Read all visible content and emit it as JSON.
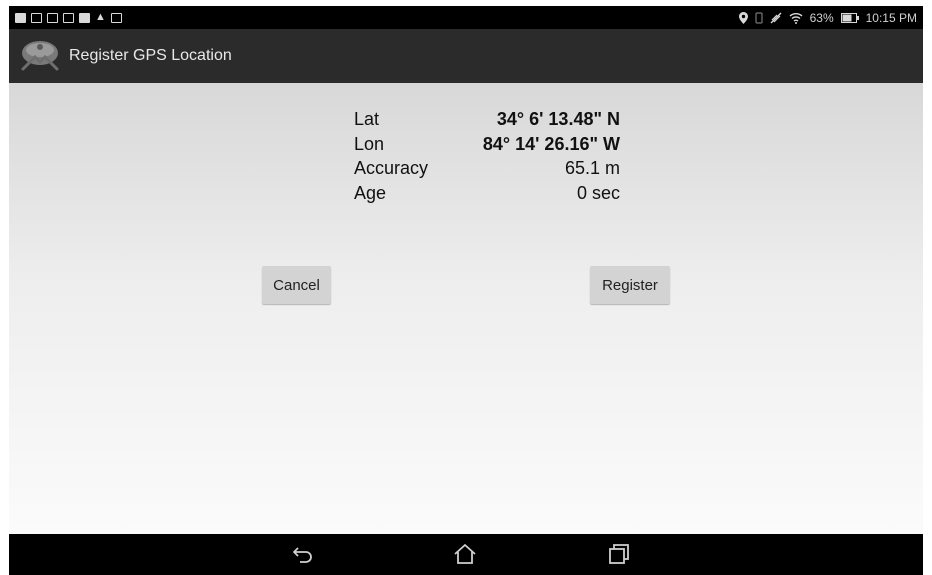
{
  "status_bar": {
    "battery": "63%",
    "time": "10:15 PM"
  },
  "app": {
    "title": "Register GPS Location"
  },
  "location": {
    "rows": [
      {
        "label": "Lat",
        "value": "34° 6' 13.48\" N"
      },
      {
        "label": "Lon",
        "value": "84° 14' 26.16\" W"
      },
      {
        "label": "Accuracy",
        "value": "65.1 m"
      },
      {
        "label": "Age",
        "value": "0 sec"
      }
    ]
  },
  "buttons": {
    "cancel": "Cancel",
    "register": "Register"
  },
  "nav": {
    "icons": [
      "back-icon",
      "home-icon",
      "recent-apps-icon"
    ]
  }
}
